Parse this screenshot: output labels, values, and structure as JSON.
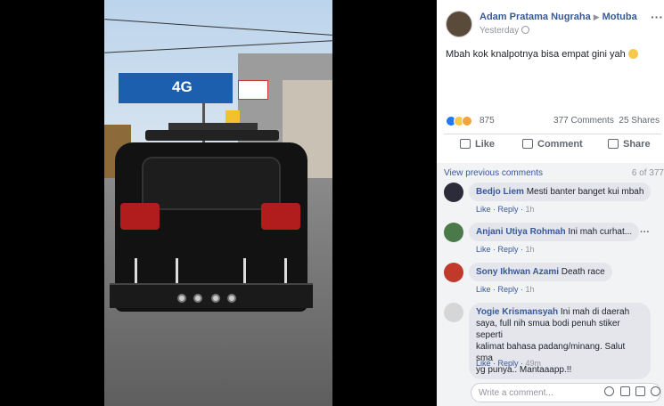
{
  "post": {
    "author": "Adam Pratama Nugraha",
    "arrow": "▶",
    "group": "Motuba",
    "time": "Yesterday",
    "more": "···",
    "text": "Mbah kok knalpotnya bisa empat gini yah"
  },
  "photo": {
    "banner_text": "4G"
  },
  "stats": {
    "reaction_count": "875",
    "comments_label": "377 Comments",
    "shares_label": "25 Shares"
  },
  "actions": {
    "like": "Like",
    "comment": "Comment",
    "share": "Share"
  },
  "comments_header": {
    "view_previous": "View previous comments",
    "count_of": "6 of 377"
  },
  "comments": [
    {
      "name": "Bedjo Liem",
      "text": "Mesti banter banget kui mbah",
      "like": "Like",
      "reply": "Reply",
      "time": "1h"
    },
    {
      "name": "Anjani Utiya Rohmah",
      "text": "Ini mah curhat...",
      "like": "Like",
      "reply": "Reply",
      "time": "1h"
    },
    {
      "name": "Sony Ikhwan Azami",
      "text": "Death race",
      "like": "Like",
      "reply": "Reply",
      "time": "1h"
    },
    {
      "name": "Yogie Krismansyah",
      "text_lines": [
        "Ini mah di daerah",
        "saya, full nih smua bodi penuh stiker seperti",
        "kalimat bahasa padang/minang. Salut sma",
        "yg punya.. Mantaaapp.!!"
      ],
      "like": "Like",
      "reply": "Reply",
      "time": "49m"
    }
  ],
  "composer": {
    "placeholder": "Write a comment..."
  },
  "colors": {
    "link": "#385898",
    "muted": "#90949c",
    "bubble": "#e4e6eb",
    "like_blue": "#2078f4"
  }
}
